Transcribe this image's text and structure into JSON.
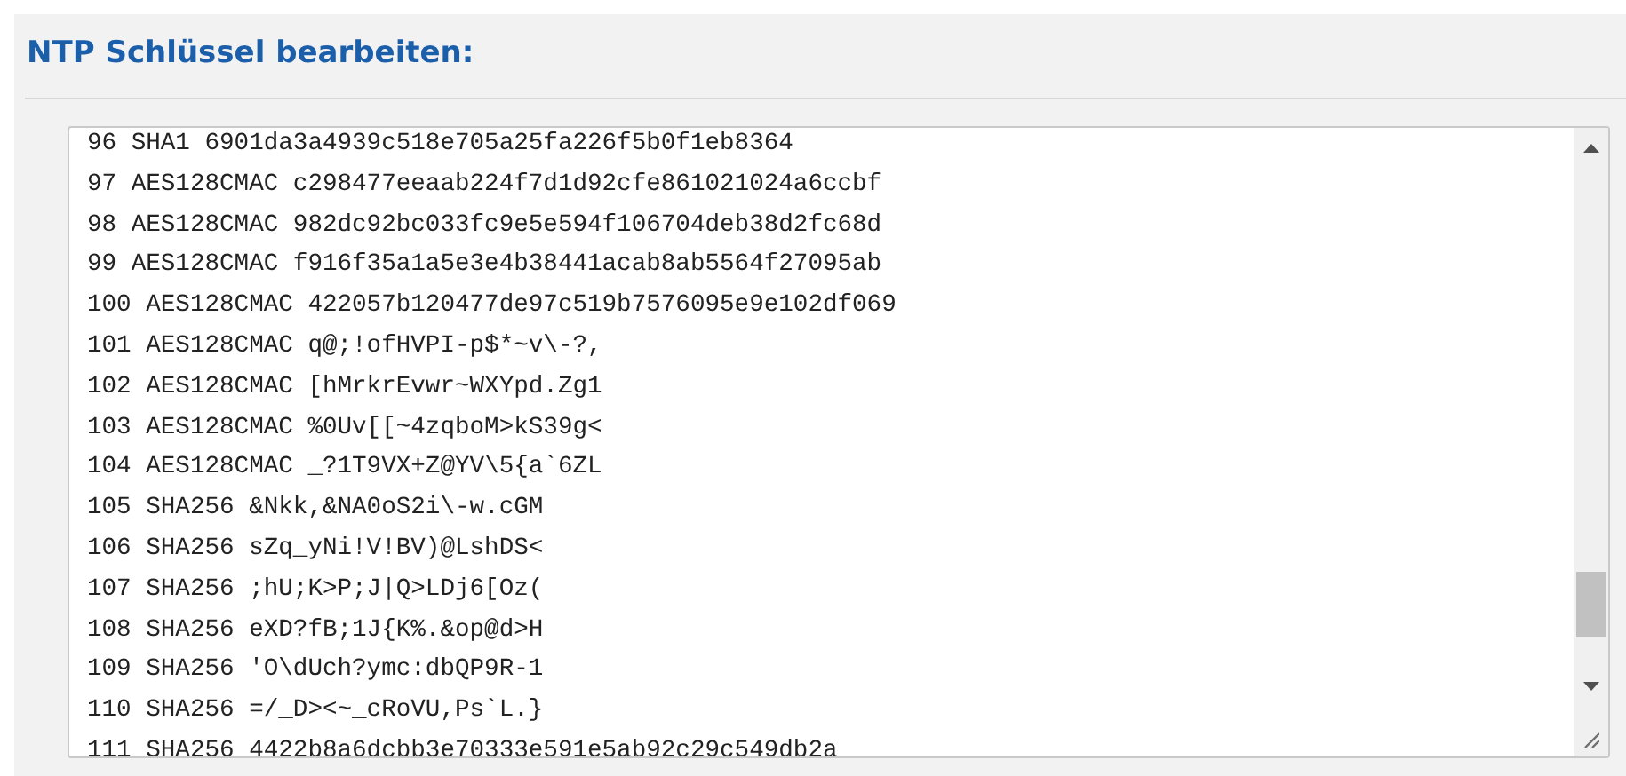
{
  "title": "NTP Schlüssel bearbeiten:",
  "key_list": {
    "lines": [
      "96 SHA1 6901da3a4939c518e705a25fa226f5b0f1eb8364",
      "97 AES128CMAC c298477eeaab224f7d1d92cfe861021024a6ccbf",
      "98 AES128CMAC 982dc92bc033fc9e5e594f106704deb38d2fc68d",
      "99 AES128CMAC f916f35a1a5e3e4b38441acab8ab5564f27095ab",
      "100 AES128CMAC 422057b120477de97c519b7576095e9e102df069",
      "101 AES128CMAC q@;!ofHVPI-p$*~v\\-?,",
      "102 AES128CMAC [hMrkrEvwr~WXYpd.Zg1",
      "103 AES128CMAC %0Uv[[~4zqboM>kS39g<",
      "104 AES128CMAC _?1T9VX+Z@YV\\5{a`6ZL",
      "105 SHA256 &Nkk,&NA0oS2i\\-w.cGM",
      "106 SHA256 sZq_yNi!V!BV)@LshDS<",
      "107 SHA256 ;hU;K>P;J|Q>LDj6[Oz(",
      "108 SHA256 eXD?fB;1J{K%.&op@d>H",
      "109 SHA256 'O\\dUch?ymc:dbQP9R-1",
      "110 SHA256 =/_D><~_cRoVU,Ps`L.}",
      "111 SHA256 4422b8a6dcbb3e70333e591e5ab92c29c549db2a"
    ]
  }
}
